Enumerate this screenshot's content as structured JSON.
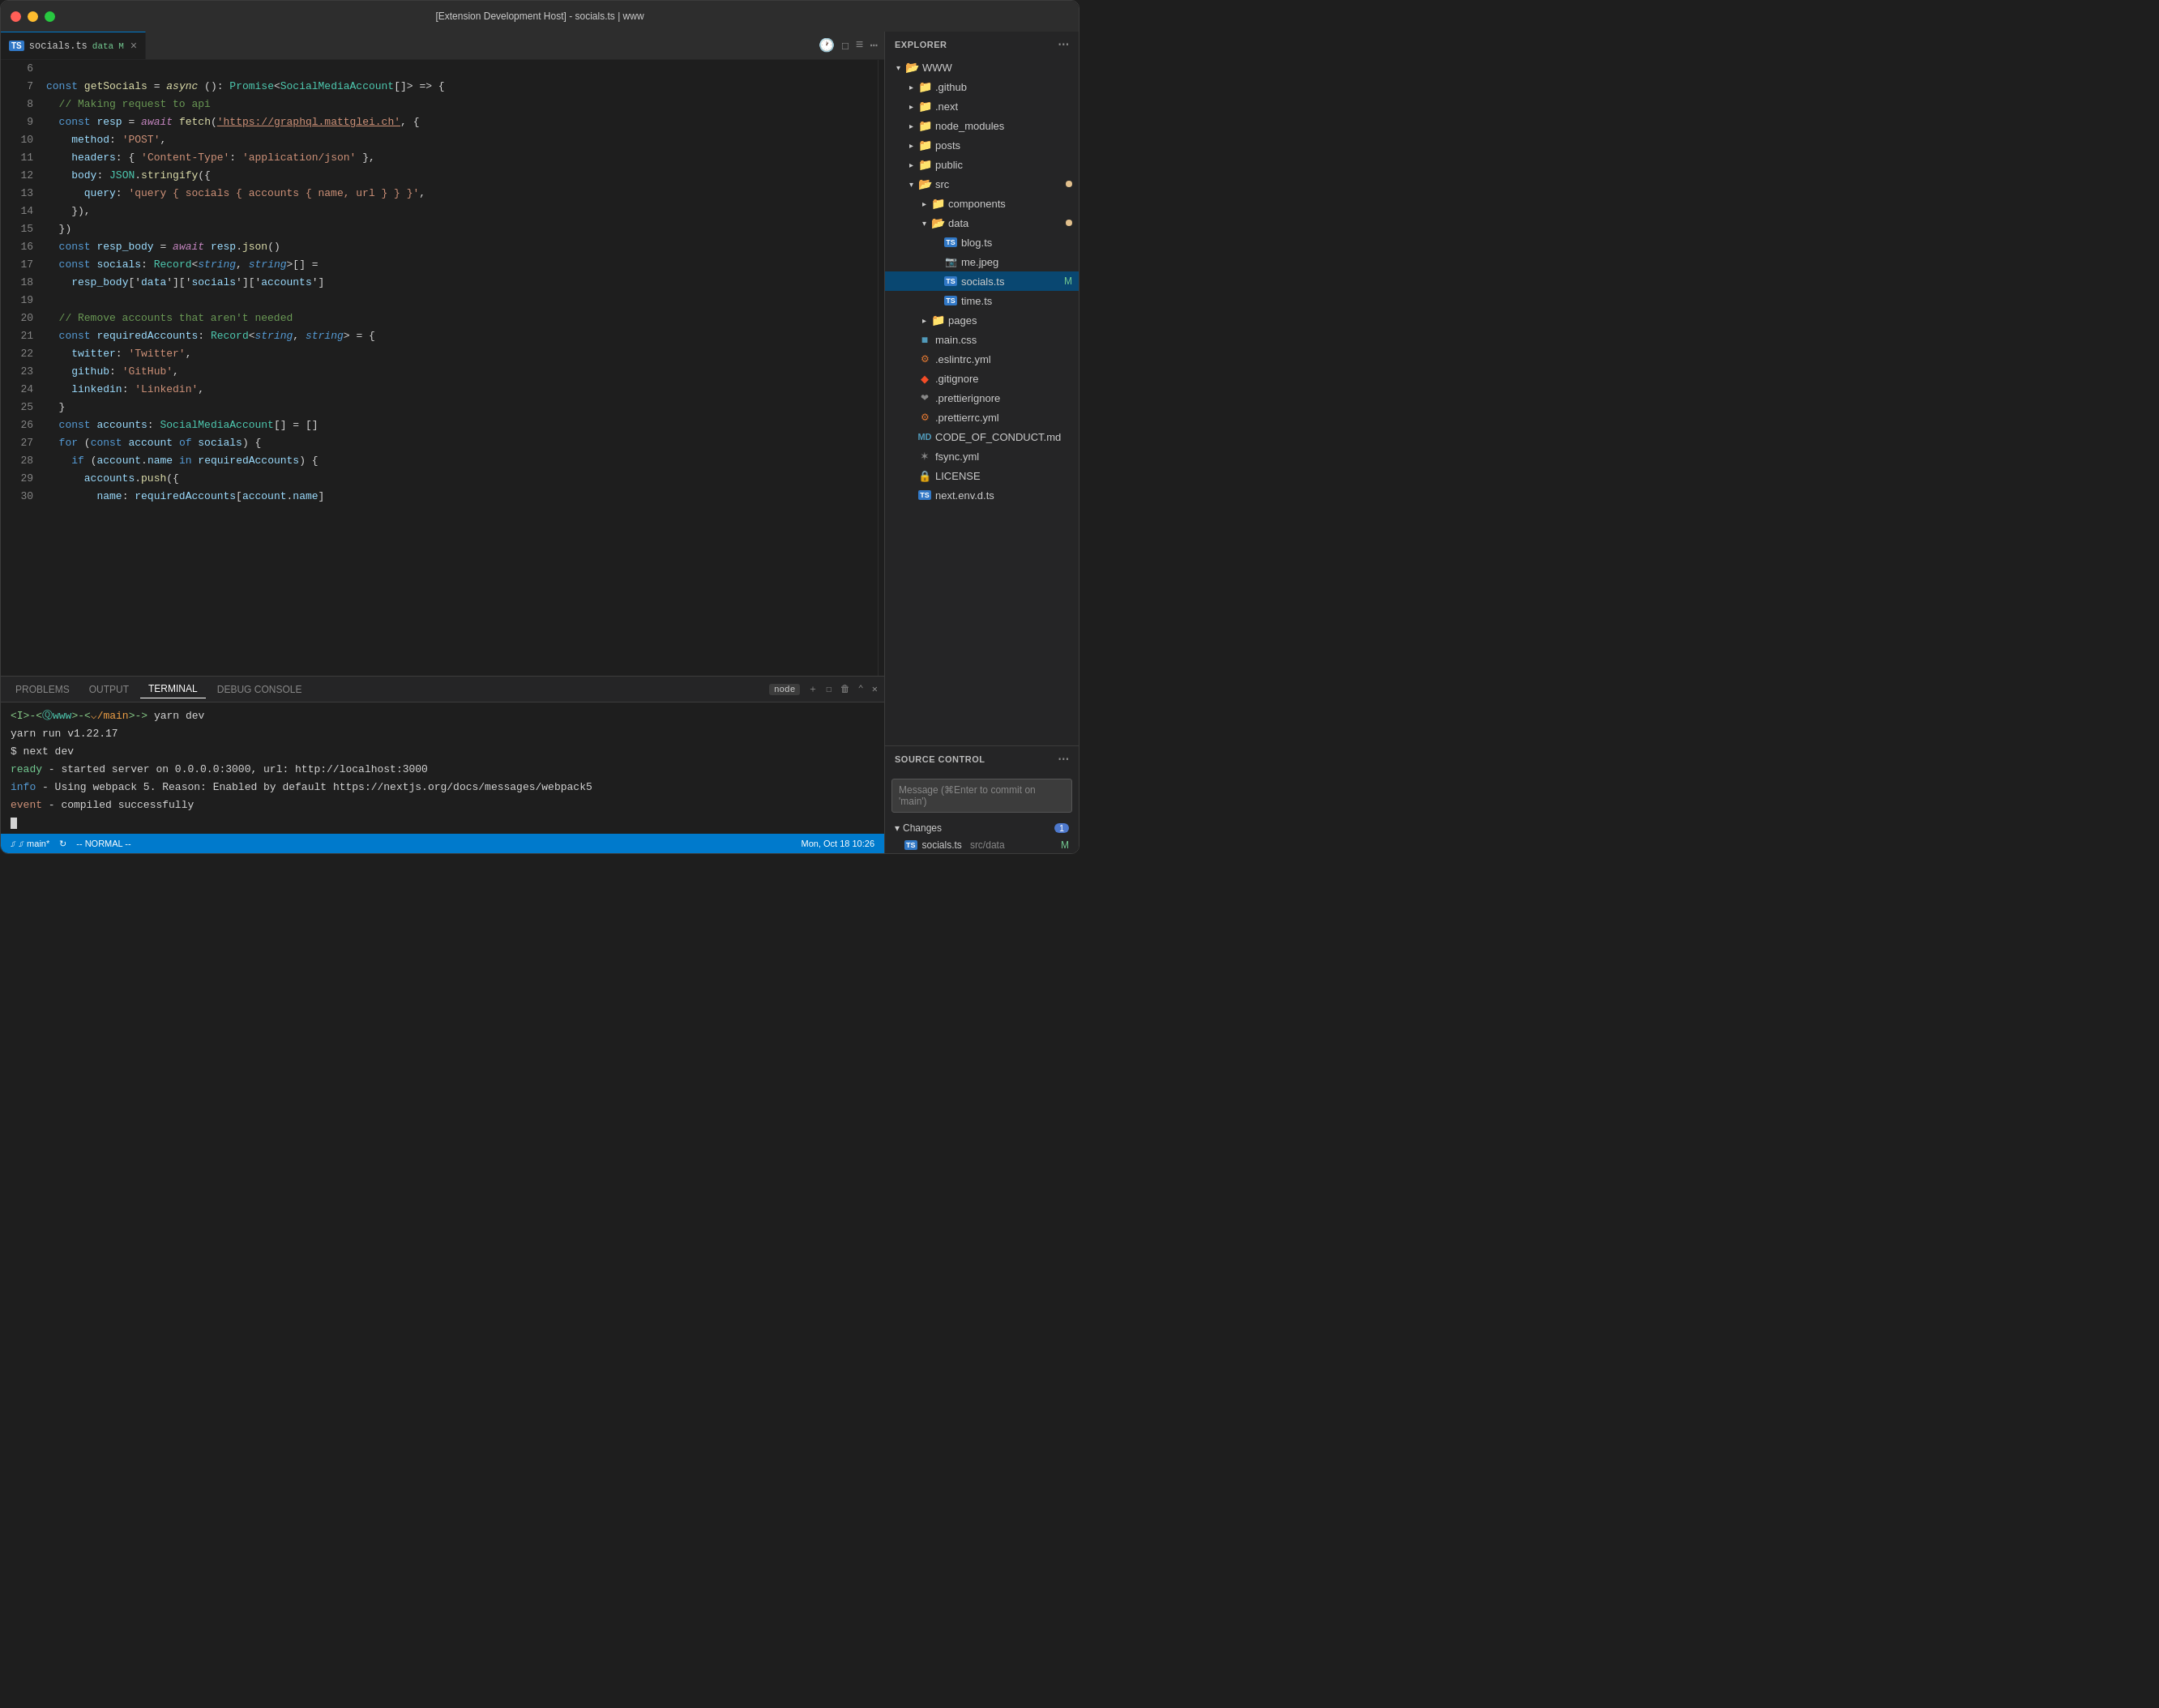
{
  "window": {
    "title": "[Extension Development Host] - socials.ts | www"
  },
  "tabs": {
    "active": {
      "lang": "TS",
      "filename": "socials.ts",
      "badge": "data",
      "modified": "M"
    },
    "actions": [
      "history-icon",
      "split-editor-icon",
      "layout-icon",
      "more-icon"
    ]
  },
  "code": {
    "lines": [
      {
        "num": "6",
        "content": ""
      },
      {
        "num": "7",
        "content": "const getSocials = async (): Promise<SocialMediaAccount[]> => {"
      },
      {
        "num": "8",
        "content": "  // Making request to api"
      },
      {
        "num": "9",
        "content": "  const resp = await fetch('https://graphql.mattglei.ch', {"
      },
      {
        "num": "10",
        "content": "    method: 'POST',"
      },
      {
        "num": "11",
        "content": "    headers: { 'Content-Type': 'application/json' },"
      },
      {
        "num": "12",
        "content": "    body: JSON.stringify({"
      },
      {
        "num": "13",
        "content": "      query: 'query { socials { accounts { name, url } } }',"
      },
      {
        "num": "14",
        "content": "    }),"
      },
      {
        "num": "15",
        "content": "  })"
      },
      {
        "num": "16",
        "content": "  const resp_body = await resp.json()"
      },
      {
        "num": "17",
        "content": "  const socials: Record<string, string>[] ="
      },
      {
        "num": "18",
        "content": "    resp_body['data']['socials']['accounts']"
      },
      {
        "num": "19",
        "content": ""
      },
      {
        "num": "20",
        "content": "  // Remove accounts that aren't needed"
      },
      {
        "num": "21",
        "content": "  const requiredAccounts: Record<string, string> = {"
      },
      {
        "num": "22",
        "content": "    twitter: 'Twitter',"
      },
      {
        "num": "23",
        "content": "    github: 'GitHub',"
      },
      {
        "num": "24",
        "content": "    linkedin: 'Linkedin',"
      },
      {
        "num": "25",
        "content": "  }"
      },
      {
        "num": "26",
        "content": "  const accounts: SocialMediaAccount[] = []"
      },
      {
        "num": "27",
        "content": "  for (const account of socials) {"
      },
      {
        "num": "28",
        "content": "    if (account.name in requiredAccounts) {"
      },
      {
        "num": "29",
        "content": "      accounts.push({"
      },
      {
        "num": "30",
        "content": "        name: requiredAccounts[account.name]"
      }
    ]
  },
  "panel": {
    "tabs": [
      "PROBLEMS",
      "OUTPUT",
      "TERMINAL",
      "DEBUG CONSOLE"
    ],
    "active_tab": "TERMINAL",
    "terminal": {
      "prompt": "<I>-<Ⓠwww>-<⌵/main>-> yarn dev",
      "line2": "yarn run v1.22.17",
      "line3": "$ next dev",
      "ready_line": "ready - started server on 0.0.0.0:3000, url: http://localhost:3000",
      "info_line": "info  - Using webpack 5. Reason: Enabled by default https://nextjs.org/docs/messages/webpack5",
      "event_line": "event - compiled successfully",
      "node_badge": "node"
    }
  },
  "status_bar": {
    "branch": "⎎ main*",
    "sync": "↻",
    "mode": "-- NORMAL --",
    "datetime": "Mon, Oct 18 10:26"
  },
  "sidebar": {
    "explorer": {
      "title": "EXPLORER",
      "root": "WWW",
      "items": [
        {
          "indent": 1,
          "type": "folder",
          "name": ".github",
          "open": false
        },
        {
          "indent": 1,
          "type": "folder",
          "name": ".next",
          "open": false
        },
        {
          "indent": 1,
          "type": "folder-special",
          "name": "node_modules",
          "open": false
        },
        {
          "indent": 1,
          "type": "folder",
          "name": "posts",
          "open": false
        },
        {
          "indent": 1,
          "type": "folder",
          "name": "public",
          "open": false
        },
        {
          "indent": 1,
          "type": "folder",
          "name": "src",
          "open": true,
          "modified": true
        },
        {
          "indent": 2,
          "type": "folder",
          "name": "components",
          "open": false
        },
        {
          "indent": 2,
          "type": "folder",
          "name": "data",
          "open": true,
          "modified": true
        },
        {
          "indent": 3,
          "type": "ts",
          "name": "blog.ts"
        },
        {
          "indent": 3,
          "type": "jpg",
          "name": "me.jpeg"
        },
        {
          "indent": 3,
          "type": "ts",
          "name": "socials.ts",
          "selected": true,
          "modified": "M"
        },
        {
          "indent": 3,
          "type": "ts",
          "name": "time.ts"
        },
        {
          "indent": 2,
          "type": "folder",
          "name": "pages",
          "open": false
        },
        {
          "indent": 1,
          "type": "css",
          "name": "main.css"
        },
        {
          "indent": 1,
          "type": "yml",
          "name": ".eslintrc.yml"
        },
        {
          "indent": 1,
          "type": "git",
          "name": ".gitignore"
        },
        {
          "indent": 1,
          "type": "prettier",
          "name": ".prettierignore"
        },
        {
          "indent": 1,
          "type": "yml",
          "name": ".prettierrc.yml"
        },
        {
          "indent": 1,
          "type": "md",
          "name": "CODE_OF_CONDUCT.md"
        },
        {
          "indent": 1,
          "type": "yml",
          "name": "fsync.yml"
        },
        {
          "indent": 1,
          "type": "license",
          "name": "LICENSE"
        },
        {
          "indent": 1,
          "type": "ts",
          "name": "next.env.d.ts"
        }
      ]
    },
    "source_control": {
      "title": "SOURCE CONTROL",
      "message_placeholder": "Message (⌘Enter to commit on 'main')",
      "changes_label": "Changes",
      "changes_count": "1",
      "files": [
        {
          "lang": "TS",
          "name": "socials.ts",
          "path": "src/data",
          "status": "M"
        }
      ]
    }
  }
}
